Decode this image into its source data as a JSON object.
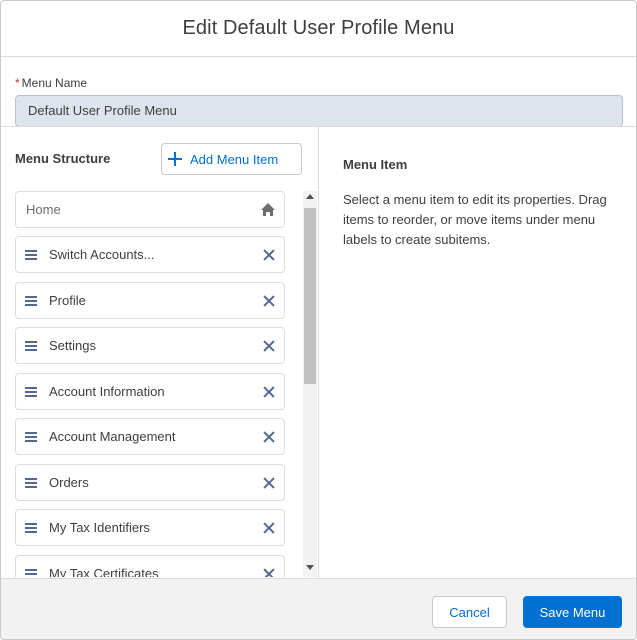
{
  "header": {
    "title": "Edit Default User Profile Menu"
  },
  "menu_name": {
    "required_mark": "*",
    "label": "Menu Name",
    "value": "Default User Profile Menu"
  },
  "structure": {
    "title": "Menu Structure",
    "add_label": "Add Menu Item",
    "home_label": "Home",
    "items": [
      {
        "label": "Switch Accounts..."
      },
      {
        "label": "Profile"
      },
      {
        "label": "Settings"
      },
      {
        "label": "Account Information"
      },
      {
        "label": "Account Management"
      },
      {
        "label": "Orders"
      },
      {
        "label": "My Tax Identifiers"
      },
      {
        "label": "My Tax Certificates"
      }
    ]
  },
  "detail": {
    "title": "Menu Item",
    "text": "Select a menu item to edit its properties. Drag items to reorder, or move items under menu labels to create subitems."
  },
  "footer": {
    "cancel_label": "Cancel",
    "save_label": "Save Menu"
  },
  "colors": {
    "brand": "#0070d2",
    "input_bg": "#dde4ee",
    "required": "#c23934"
  },
  "icons": {
    "add": "plus-icon",
    "home": "home-icon",
    "drag": "drag-handle-icon",
    "remove": "close-icon"
  }
}
